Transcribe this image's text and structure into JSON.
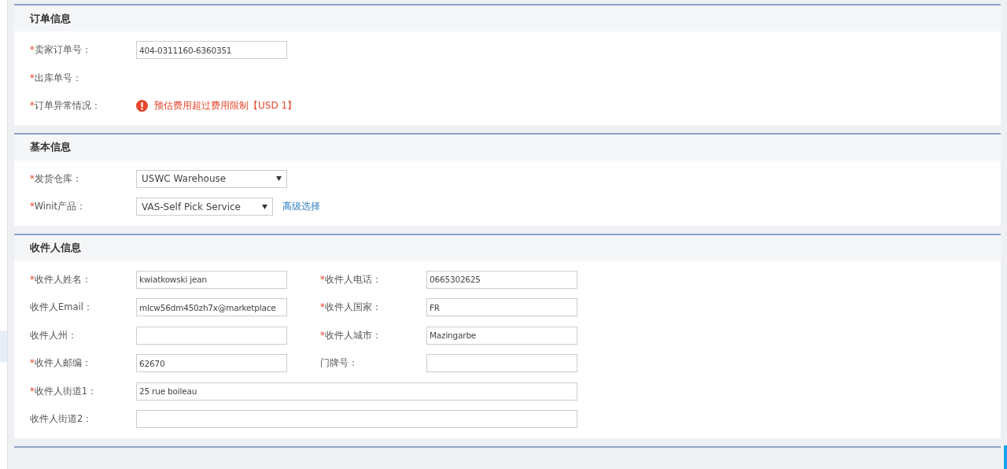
{
  "sections": [
    {
      "title": "订单信息",
      "rows": [
        [
          {
            "kind": "input",
            "mark": "*",
            "label": "卖家订单号：",
            "value": "404-0311160-6360351"
          }
        ],
        [
          {
            "kind": "text",
            "mark": "*",
            "label": "出库单号："
          }
        ],
        [
          {
            "kind": "alert",
            "mark": "*",
            "label": "订单异常情况：",
            "value": "预估费用超过费用限制【USD 1】"
          }
        ]
      ]
    },
    {
      "title": "基本信息",
      "rows": [
        [
          {
            "kind": "select",
            "mark": "*",
            "label": "发货仓库：",
            "value": "USWC Warehouse"
          }
        ],
        [
          {
            "kind": "select",
            "mark": "*",
            "label": "Winit产品：",
            "value": "VAS-Self Pick Service",
            "link": "高级选择"
          }
        ]
      ]
    },
    {
      "title": "收件人信息",
      "rows": [
        [
          {
            "kind": "input",
            "mark": "*",
            "label": "收件人姓名：",
            "value": "kwiatkowski jean"
          },
          {
            "kind": "input",
            "mark": "*",
            "label": "收件人电话：",
            "value": "0665302625"
          }
        ],
        [
          {
            "kind": "input",
            "label": "收件人Email：",
            "value": "mlcw56dm450zh7x@marketplace"
          },
          {
            "kind": "input",
            "mark": "*",
            "label": "收件人国家：",
            "value": "FR"
          }
        ],
        [
          {
            "kind": "input",
            "label": "收件人州："
          },
          {
            "kind": "input",
            "mark": "*",
            "label": "收件人城市：",
            "value": "Mazingarbe"
          }
        ],
        [
          {
            "kind": "input",
            "mark": "*",
            "label": "收件人邮编：",
            "value": "62670"
          },
          {
            "kind": "input",
            "label": "门牌号："
          }
        ],
        [
          {
            "kind": "wide",
            "mark": "*",
            "label": "收件人街道1：",
            "value": "25 rue boileau"
          }
        ],
        [
          {
            "kind": "wide",
            "label": "收件人街道2："
          }
        ]
      ]
    }
  ]
}
